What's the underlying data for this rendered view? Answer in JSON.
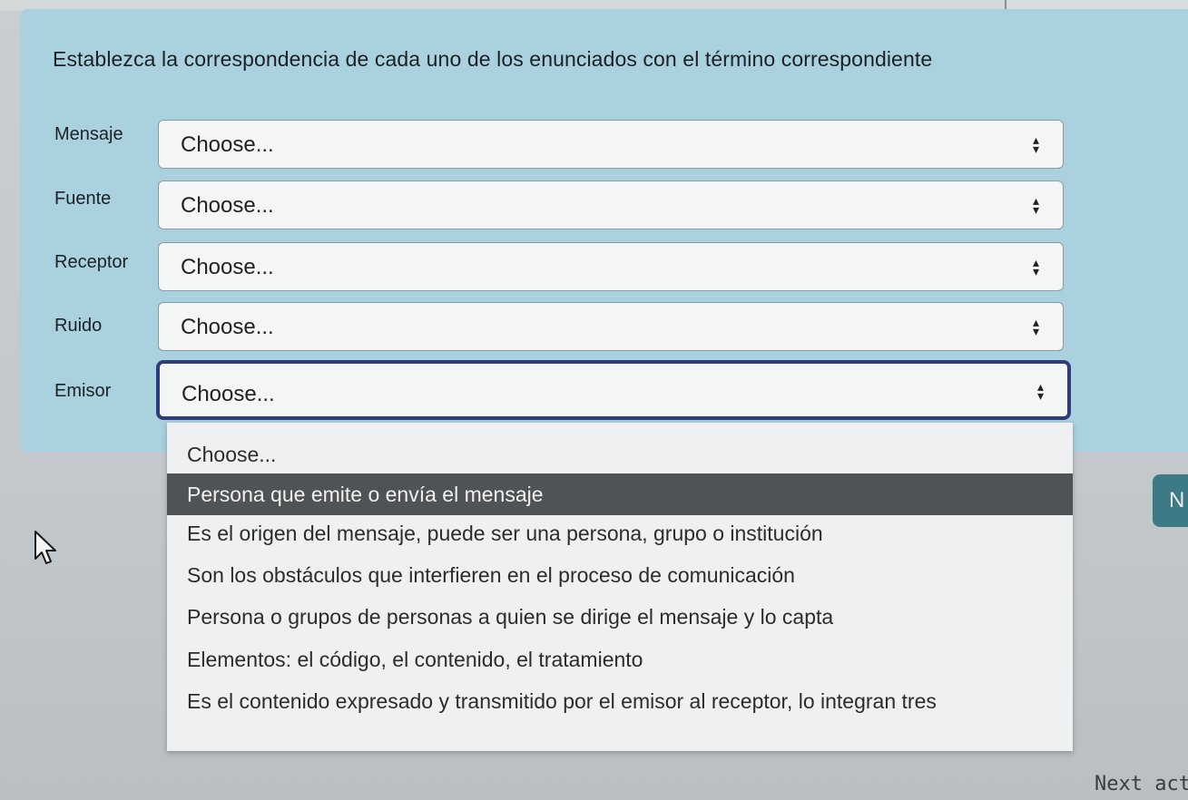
{
  "question": {
    "text": "Establezca la correspondencia de cada uno de los enunciados con el término correspondiente"
  },
  "rows": [
    {
      "label": "Mensaje",
      "selected": "Choose..."
    },
    {
      "label": "Fuente",
      "selected": "Choose..."
    },
    {
      "label": "Receptor",
      "selected": "Choose..."
    },
    {
      "label": "Ruido",
      "selected": "Choose..."
    },
    {
      "label": "Emisor",
      "selected": "Choose..."
    }
  ],
  "dropdown": {
    "options": [
      "Choose...",
      "Persona que emite o envía el mensaje",
      "Es el origen del mensaje, puede ser una persona, grupo o institución",
      "Son los obstáculos que interfieren en el proceso de comunicación",
      "Persona o grupos de personas a quien se dirige el mensaje y lo capta",
      "Elementos: el código, el contenido, el tratamiento",
      "Es el contenido expresado y transmitido por el emisor al receptor, lo integran tres"
    ],
    "highlighted_index": 1
  },
  "side_button": {
    "label": "N"
  },
  "footer": {
    "next_label": "Next act"
  },
  "colors": {
    "panel": "#a9d1de",
    "focus_border": "#2f3b7a",
    "highlight": "#505355",
    "side_button": "#3c7a86"
  },
  "icons": {
    "select_arrow": "up-down-arrow-icon",
    "cursor": "mouse-pointer-icon"
  }
}
